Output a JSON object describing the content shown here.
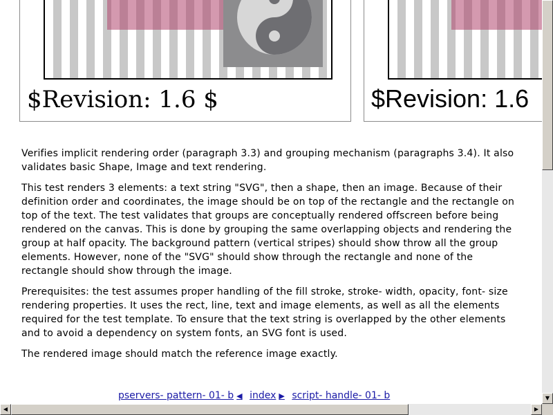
{
  "test_panels": {
    "reference_revision": "$Revision: 1.6 $",
    "rendered_revision": "$Revision: 1.6"
  },
  "description": {
    "paragraphs": [
      "Verifies implicit rendering order (paragraph 3.3) and grouping mechanism (paragraphs 3.4). It also validates basic Shape, Image and text rendering.",
      "This test renders 3 elements: a text string \"SVG\", then a shape, then an image. Because of their definition order and coordinates, the image should be on top of the rectangle and the rectangle on top of the text. The test validates that groups are conceptually rendered offscreen before being rendered on the canvas. This is done by grouping the same overlapping objects and rendering the group at half opacity. The background pattern (vertical stripes) should show throw all the group elements. However, none of the \"SVG\" should show through the rectangle and none of the rectangle should show through the image.",
      "Prerequisites: the test assumes proper handling of the fill stroke, stroke- width, opacity, font- size rendering properties. It uses the rect, line, text and image elements, as well as all the elements required for the test template. To ensure that the text string is overlapped by the other elements and to avoid a dependency on system fonts, an SVG font is used.",
      "The rendered image should match the reference image exactly."
    ]
  },
  "navigation": {
    "prev_link": "pservers- pattern- 01- b",
    "index_link": "index",
    "next_link": "script- handle- 01- b"
  },
  "icons": {
    "image_icon": "yin-yang-icon",
    "prev_icon": "arrow-left-icon",
    "next_icon": "arrow-right-icon"
  },
  "colors": {
    "rect_fill": "#b0466e",
    "link": "#1a1aa6",
    "stripe": "#c8c8c8"
  }
}
